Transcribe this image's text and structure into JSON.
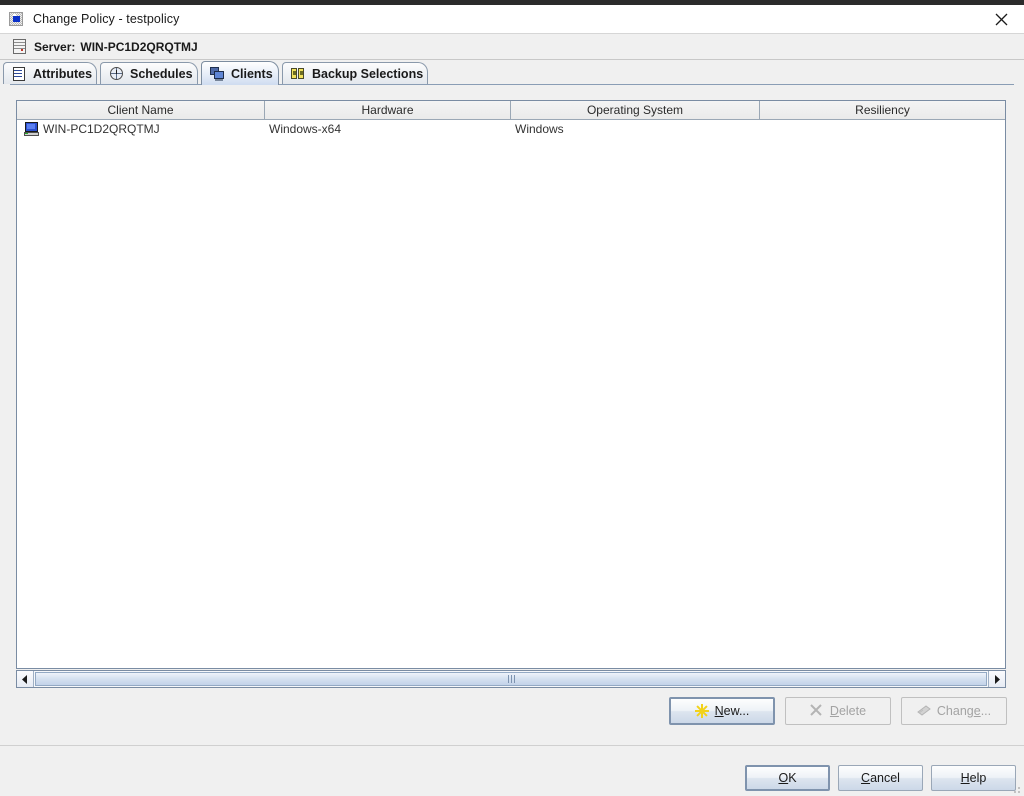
{
  "window": {
    "title": "Change Policy - testpolicy",
    "icon": "policy-icon",
    "close_icon": "close-icon"
  },
  "server_bar": {
    "icon": "server-icon",
    "label": "Server:",
    "value": "WIN-PC1D2QRQTMJ"
  },
  "tabs": [
    {
      "label": "Attributes",
      "icon": "attributes-icon",
      "selected": false
    },
    {
      "label": "Schedules",
      "icon": "schedules-clock-icon",
      "selected": false
    },
    {
      "label": "Clients",
      "icon": "clients-monitors-icon",
      "selected": true
    },
    {
      "label": "Backup Selections",
      "icon": "backup-selections-icon",
      "selected": false
    }
  ],
  "table": {
    "columns": [
      "Client Name",
      "Hardware",
      "Operating System",
      "Resiliency"
    ],
    "rows": [
      {
        "icon": "computer-icon",
        "client_name": "WIN-PC1D2QRQTMJ",
        "hardware": "Windows-x64",
        "operating_system": "Windows",
        "resiliency": ""
      }
    ]
  },
  "scrollbar": {
    "left_arrow": "◀",
    "right_arrow": "▶",
    "grip": "scrollbar-grip"
  },
  "action_buttons": {
    "new": {
      "label_pre": "",
      "label": "New...",
      "accel": "N",
      "icon": "new-star-icon",
      "enabled": true,
      "default": true
    },
    "delete": {
      "label": "Delete",
      "accel": "D",
      "icon": "delete-x-icon",
      "enabled": false,
      "default": false
    },
    "change": {
      "label": "Change...",
      "accel": "e",
      "icon": "change-edit-icon",
      "enabled": false,
      "default": false
    }
  },
  "dialog_buttons": {
    "ok": {
      "label": "OK",
      "accel": "O",
      "default": true
    },
    "cancel": {
      "label": "Cancel",
      "accel": "C",
      "default": false
    },
    "help": {
      "label": "Help",
      "accel": "H",
      "default": false
    }
  },
  "colors": {
    "accent": "#2b4fcf",
    "tab_selected": "#cfdcf0",
    "panel_bg": "#f0f0f0",
    "border": "#7a8ca3",
    "disabled_text": "#a3a3a3"
  }
}
